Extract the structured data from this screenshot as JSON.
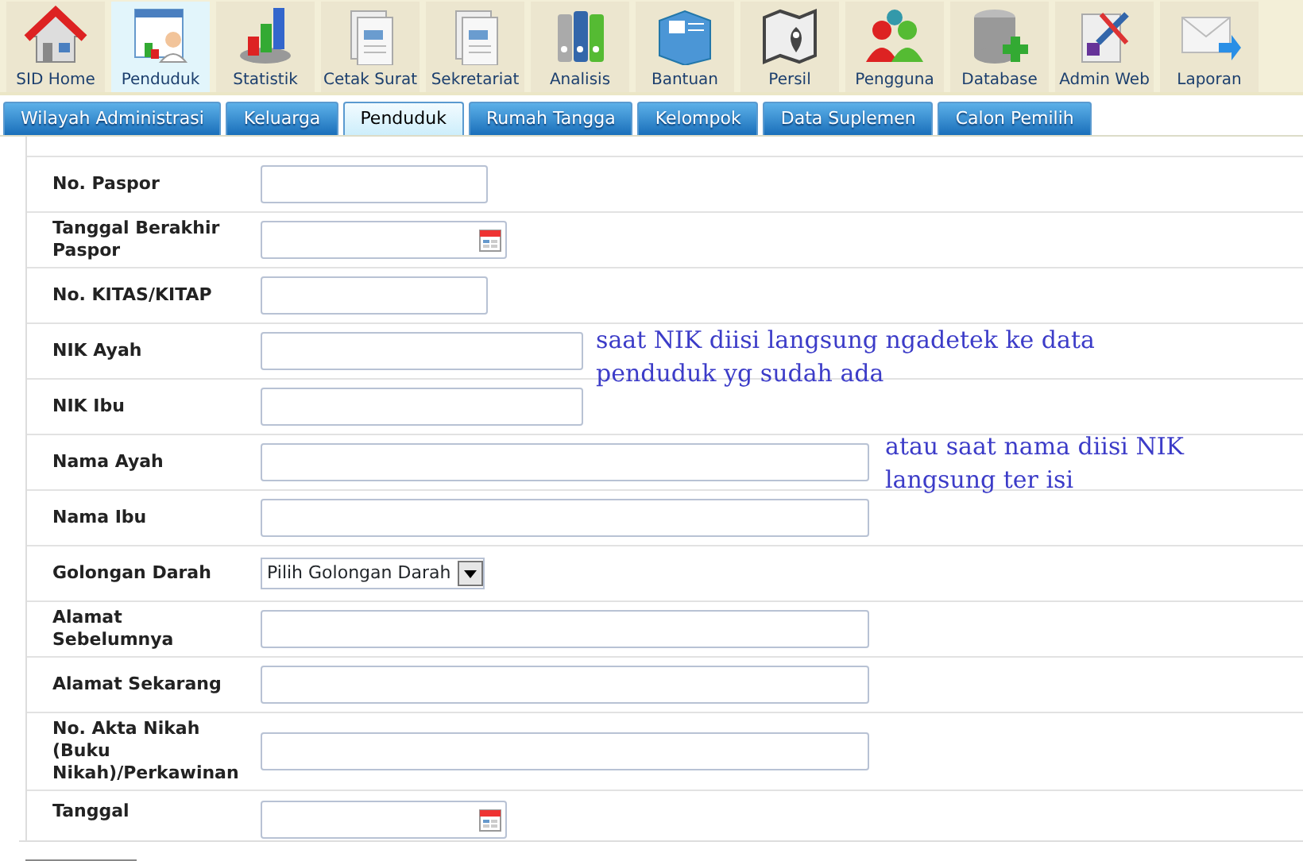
{
  "menu": [
    {
      "label": "SID Home",
      "selected": false
    },
    {
      "label": "Penduduk",
      "selected": true
    },
    {
      "label": "Statistik",
      "selected": false
    },
    {
      "label": "Cetak Surat",
      "selected": false
    },
    {
      "label": "Sekretariat",
      "selected": false
    },
    {
      "label": "Analisis",
      "selected": false
    },
    {
      "label": "Bantuan",
      "selected": false
    },
    {
      "label": "Persil",
      "selected": false
    },
    {
      "label": "Pengguna",
      "selected": false
    },
    {
      "label": "Database",
      "selected": false
    },
    {
      "label": "Admin Web",
      "selected": false
    },
    {
      "label": "Laporan",
      "selected": false
    }
  ],
  "tabs": [
    {
      "label": "Wilayah Administrasi",
      "selected": false
    },
    {
      "label": "Keluarga",
      "selected": false
    },
    {
      "label": "Penduduk",
      "selected": true
    },
    {
      "label": "Rumah Tangga",
      "selected": false
    },
    {
      "label": "Kelompok",
      "selected": false
    },
    {
      "label": "Data Suplemen",
      "selected": false
    },
    {
      "label": "Calon Pemilih",
      "selected": false
    }
  ],
  "form_rows": [
    {
      "label": "No. Paspor",
      "kind": "text"
    },
    {
      "label": "Tanggal Berakhir Paspor",
      "kind": "date"
    },
    {
      "label": "No. KITAS/KITAP",
      "kind": "text"
    },
    {
      "label": "NIK Ayah",
      "kind": "text"
    },
    {
      "label": "NIK Ibu",
      "kind": "text"
    },
    {
      "label": "Nama Ayah",
      "kind": "text"
    },
    {
      "label": "Nama Ibu",
      "kind": "text"
    },
    {
      "label": "Golongan Darah",
      "kind": "select",
      "value": "Pilih Golongan Darah"
    },
    {
      "label": "Alamat Sebelumnya",
      "kind": "text"
    },
    {
      "label": "Alamat Sekarang",
      "kind": "text"
    },
    {
      "label": "No. Akta Nikah (Buku Nikah)/Perkawinan",
      "kind": "text"
    },
    {
      "label": "Tanggal",
      "kind": "date"
    }
  ],
  "annotations": [
    {
      "text": "saat NIK diisi langsung ngadetek ke data penduduk yg sudah ada"
    },
    {
      "text": "atau saat nama diisi NIK langsung ter isi"
    }
  ]
}
